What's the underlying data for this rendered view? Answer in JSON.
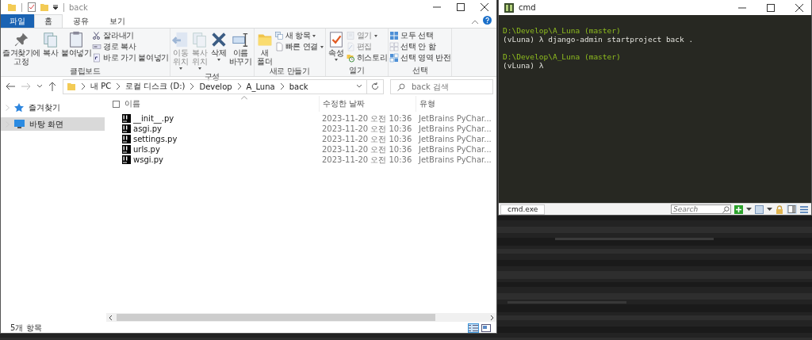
{
  "explorer": {
    "title": "back",
    "ribbon_tabs": [
      {
        "label": "파일",
        "kind": "file",
        "selected": false
      },
      {
        "label": "홈",
        "kind": "tab",
        "selected": true
      },
      {
        "label": "공유",
        "kind": "tab",
        "selected": false
      },
      {
        "label": "보기",
        "kind": "tab",
        "selected": false
      }
    ],
    "ribbon_groups": [
      {
        "label": "클립보드",
        "large": [
          {
            "label": "즐겨찾기에\n고정",
            "disabled": false,
            "dropdown": false
          },
          {
            "label": "복사",
            "disabled": false,
            "dropdown": false
          },
          {
            "label": "붙여넣기",
            "disabled": false,
            "dropdown": false
          }
        ],
        "small": [
          {
            "label": "잘라내기",
            "disabled": false,
            "dropdown": false
          },
          {
            "label": "경로 복사",
            "disabled": false,
            "dropdown": false
          },
          {
            "label": "바로 가기 붙여넣기",
            "disabled": false,
            "dropdown": false
          }
        ]
      },
      {
        "label": "구성",
        "large": [
          {
            "label": "이동\n위치",
            "disabled": true,
            "dropdown": true
          },
          {
            "label": "복사\n위치",
            "disabled": true,
            "dropdown": true
          },
          {
            "label": "삭제",
            "disabled": false,
            "dropdown": true
          },
          {
            "label": "이름\n바꾸기",
            "disabled": false,
            "dropdown": false
          }
        ]
      },
      {
        "label": "새로 만들기",
        "large": [
          {
            "label": "새\n폴더",
            "disabled": false,
            "dropdown": false
          }
        ],
        "small": [
          {
            "label": "새 항목",
            "disabled": false,
            "dropdown": true
          },
          {
            "label": "빠른 연결",
            "disabled": false,
            "dropdown": true
          }
        ]
      },
      {
        "label": "열기",
        "large": [
          {
            "label": "속성",
            "disabled": false,
            "dropdown": true
          }
        ],
        "small": [
          {
            "label": "열기",
            "disabled": true,
            "dropdown": true
          },
          {
            "label": "편집",
            "disabled": true,
            "dropdown": false
          },
          {
            "label": "히스토리",
            "disabled": false,
            "dropdown": false
          }
        ]
      },
      {
        "label": "선택",
        "small": [
          {
            "label": "모두 선택",
            "disabled": false,
            "dropdown": false
          },
          {
            "label": "선택 안 함",
            "disabled": false,
            "dropdown": false
          },
          {
            "label": "선택 영역 반전",
            "disabled": false,
            "dropdown": false
          }
        ]
      }
    ],
    "address": [
      "내 PC",
      "로컬 디스크 (D:)",
      "Develop",
      "A_Luna",
      "back"
    ],
    "search": {
      "placeholder": "back 검색"
    },
    "sidebar": [
      {
        "label": "즐겨찾기",
        "kind": "star",
        "selected": false
      },
      {
        "label": "바탕 화면",
        "kind": "desktop",
        "selected": true
      }
    ],
    "select_all": {
      "checked": false
    },
    "columns": [
      "이름",
      "수정한 날짜",
      "유형"
    ],
    "files": [
      {
        "name": "__init__.py",
        "modified": "2023-11-20 오전 10:36",
        "type": "JetBrains PyChar..."
      },
      {
        "name": "asgi.py",
        "modified": "2023-11-20 오전 10:36",
        "type": "JetBrains PyChar..."
      },
      {
        "name": "settings.py",
        "modified": "2023-11-20 오전 10:36",
        "type": "JetBrains PyChar..."
      },
      {
        "name": "urls.py",
        "modified": "2023-11-20 오전 10:36",
        "type": "JetBrains PyChar..."
      },
      {
        "name": "wsgi.py",
        "modified": "2023-11-20 오전 10:36",
        "type": "JetBrains PyChar..."
      }
    ],
    "status": "5개 항목",
    "views": [
      {
        "kind": "details",
        "selected": true
      },
      {
        "kind": "large-icons",
        "selected": false
      }
    ]
  },
  "console": {
    "title": "cmd",
    "prompts": [
      {
        "path": "D:\\Develop\\A_Luna (master)",
        "command": "(vLuna) λ django-admin startproject back ."
      },
      {
        "path": "D:\\Develop\\A_Luna (master)",
        "command": "(vLuna) λ"
      }
    ],
    "tabs": [
      {
        "label": "cmd.exe",
        "selected": true
      }
    ],
    "search": {
      "placeholder": "Search"
    }
  }
}
